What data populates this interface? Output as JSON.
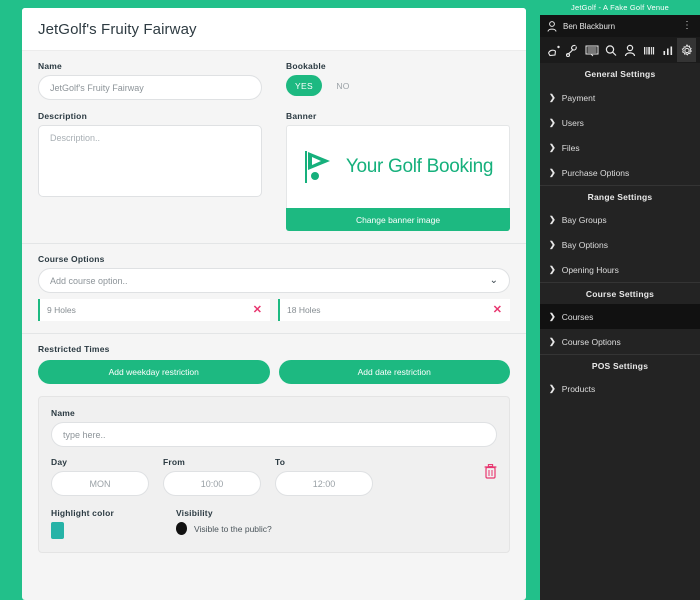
{
  "window": {
    "title": "JetGolf - A Fake Golf Venue"
  },
  "card": {
    "title": "JetGolf's Fruity Fairway",
    "name": {
      "label": "Name",
      "value": "JetGolf's Fruity Fairway"
    },
    "description": {
      "label": "Description",
      "placeholder": "Description.."
    },
    "bookable": {
      "label": "Bookable",
      "yes": "YES",
      "no": "NO",
      "selected": "YES"
    },
    "banner": {
      "label": "Banner",
      "logo_text": "Your Golf Booking",
      "change_button": "Change banner image"
    },
    "course_options": {
      "label": "Course Options",
      "select_placeholder": "Add course option..",
      "chips": [
        {
          "label": "9 Holes",
          "remove": "✕"
        },
        {
          "label": "18 Holes",
          "remove": "✕"
        }
      ]
    },
    "restricted_times": {
      "label": "Restricted Times",
      "add_weekday": "Add weekday restriction",
      "add_date": "Add date restriction",
      "entry": {
        "name_label": "Name",
        "name_placeholder": "type here..",
        "day_label": "Day",
        "day_value": "MON",
        "from_label": "From",
        "from_value": "10:00",
        "to_label": "To",
        "to_value": "12:00",
        "highlight_label": "Highlight color",
        "highlight_color": "#26b3a7",
        "visibility_label": "Visibility",
        "visibility_text": "Visible to the public?"
      }
    }
  },
  "sidebar": {
    "user": "Ben Blackburn",
    "toolbar_icons": [
      "golf-swing-icon",
      "golf-club-icon",
      "keyboard-icon",
      "search-icon",
      "person-icon",
      "barcode-icon",
      "bar-chart-icon",
      "gear-icon"
    ],
    "groups": [
      {
        "heading": "General Settings",
        "items": [
          {
            "label": "Payment",
            "active": false
          },
          {
            "label": "Users",
            "active": false
          },
          {
            "label": "Files",
            "active": false
          },
          {
            "label": "Purchase Options",
            "active": false
          }
        ]
      },
      {
        "heading": "Range Settings",
        "items": [
          {
            "label": "Bay Groups",
            "active": false
          },
          {
            "label": "Bay Options",
            "active": false
          },
          {
            "label": "Opening Hours",
            "active": false
          }
        ]
      },
      {
        "heading": "Course Settings",
        "items": [
          {
            "label": "Courses",
            "active": true
          },
          {
            "label": "Course Options",
            "active": false
          }
        ]
      },
      {
        "heading": "POS Settings",
        "items": [
          {
            "label": "Products",
            "active": false
          }
        ]
      }
    ]
  },
  "colors": {
    "brand_green": "#22c08a",
    "button_green": "#1db981",
    "accent_pink": "#e8366f",
    "sidebar_dark": "#232323",
    "sidebar_active": "#111111"
  }
}
